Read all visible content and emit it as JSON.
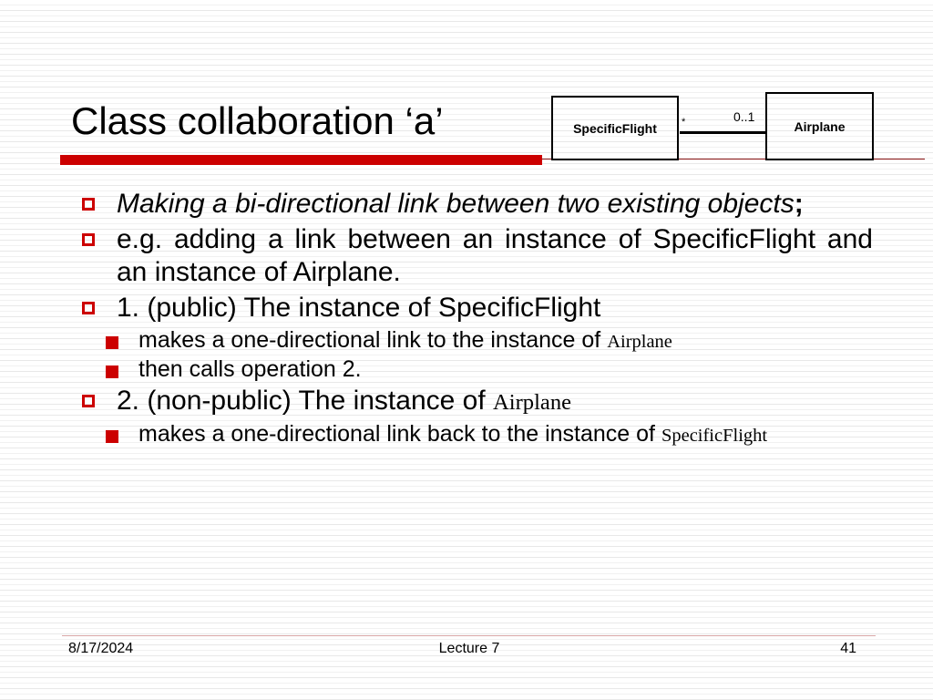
{
  "slide": {
    "title": "Class collaboration ‘a’",
    "accent_color": "#cc0000",
    "rule_color": "#8a1515",
    "footer_rule_color": "#d9a7a7",
    "background_color": "#ffffff"
  },
  "diagram": {
    "type": "uml-class-association",
    "source_class": "SpecificFlight",
    "target_class": "Airplane",
    "source_multiplicity": "*",
    "target_multiplicity": "0..1"
  },
  "content": {
    "bullets": [
      {
        "level": 1,
        "marker": "hollow-square",
        "style": "italic",
        "justified": true,
        "text_parts": [
          {
            "text": "Making a bi-directional link between two existing objects",
            "font": "italic"
          },
          {
            "text": ";",
            "font": "bold"
          }
        ],
        "plain": "Making a bi-directional link between two existing objects;"
      },
      {
        "level": 1,
        "marker": "hollow-square",
        "style": "regular",
        "justified": true,
        "text_parts": [
          {
            "text": "e.g. adding a link between an instance of SpecificFlight and an instance of Airplane.",
            "font": "regular"
          }
        ],
        "plain": "e.g. adding a link between an instance of SpecificFlight and an instance of Airplane."
      },
      {
        "level": 1,
        "marker": "hollow-square",
        "style": "regular",
        "justified": false,
        "text_parts": [
          {
            "text": "1.  (public) The instance of SpecificFlight",
            "font": "regular"
          }
        ],
        "plain": "1.  (public) The instance of SpecificFlight"
      },
      {
        "level": 2,
        "marker": "solid-square",
        "style": "regular",
        "justified": true,
        "text_parts": [
          {
            "text": "makes a one-directional link to the instance of ",
            "font": "regular"
          },
          {
            "text": "Airplane",
            "font": "serif"
          }
        ],
        "plain": "makes a one-directional link to the instance of Airplane"
      },
      {
        "level": 2,
        "marker": "solid-square",
        "style": "regular",
        "justified": false,
        "text_parts": [
          {
            "text": "then calls operation 2.",
            "font": "regular"
          }
        ],
        "plain": "then calls operation 2."
      },
      {
        "level": 1,
        "marker": "hollow-square",
        "style": "regular",
        "justified": false,
        "text_parts": [
          {
            "text": "2.  (non-public) The instance of ",
            "font": "regular"
          },
          {
            "text": "Airplane",
            "font": "serif"
          }
        ],
        "plain": "2.  (non-public) The instance of Airplane"
      },
      {
        "level": 2,
        "marker": "solid-square",
        "style": "regular",
        "justified": true,
        "text_parts": [
          {
            "text": "makes a one-directional link back to the instance of ",
            "font": "regular"
          },
          {
            "text": "SpecificFlight",
            "font": "serif"
          }
        ],
        "plain": "makes a one-directional link back to the instance of SpecificFlight"
      }
    ]
  },
  "footer": {
    "date": "8/17/2024",
    "center": "Lecture 7",
    "page_number": "41"
  }
}
